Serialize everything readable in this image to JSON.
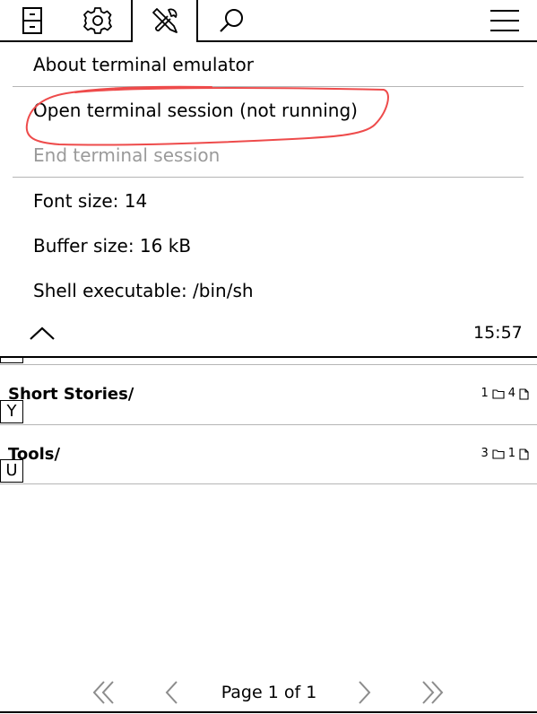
{
  "topbar": {
    "tabs": [
      {
        "name": "file-cabinet-icon"
      },
      {
        "name": "gear-icon"
      },
      {
        "name": "tools-icon",
        "active": true
      },
      {
        "name": "search-icon"
      }
    ],
    "menu_icon": "hamburger-menu-icon"
  },
  "menu": {
    "items": [
      {
        "label": "About terminal emulator",
        "enabled": true
      },
      {
        "label": "Open terminal session (not running)",
        "enabled": true,
        "highlighted": true
      },
      {
        "label": "End terminal session",
        "enabled": false
      },
      {
        "label": "Font size: 14",
        "enabled": true
      },
      {
        "label": "Buffer size: 16 kB",
        "enabled": true
      },
      {
        "label": "Shell executable: /bin/sh",
        "enabled": true
      }
    ],
    "collapse_icon": "chevron-up-icon",
    "clock": "15:57",
    "annotation_color": "#ee4b4b"
  },
  "list": {
    "rows": [
      {
        "title": "Short Stories/",
        "folders": "1",
        "files": "4",
        "key": "Y"
      },
      {
        "title": "Tools/",
        "folders": "3",
        "files": "1",
        "key": "U"
      }
    ]
  },
  "pager": {
    "label": "Page 1 of 1",
    "first_icon": "double-chevron-left-icon",
    "prev_icon": "chevron-left-icon",
    "next_icon": "chevron-right-icon",
    "last_icon": "double-chevron-right-icon",
    "disabled_color": "#8c8c8c"
  }
}
